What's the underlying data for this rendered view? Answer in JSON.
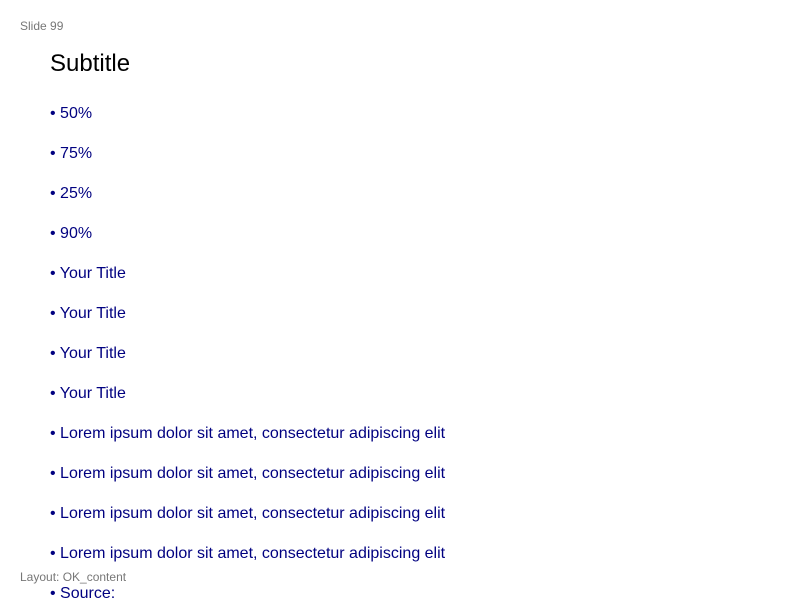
{
  "slide": {
    "number_label": "Slide 99",
    "title": "Subtitle",
    "layout_label": "Layout: OK_content",
    "bullets": [
      "• 50%",
      "• 75%",
      "• 25%",
      "• 90%",
      "• Your Title",
      "• Your Title",
      "• Your Title",
      "• Your Title",
      "• Lorem ipsum dolor sit amet, consectetur adipiscing elit",
      "• Lorem ipsum dolor sit amet, consectetur adipiscing elit",
      "• Lorem ipsum dolor sit amet, consectetur adipiscing elit",
      "• Lorem ipsum dolor sit amet, consectetur adipiscing elit",
      "• Source:"
    ]
  },
  "colors": {
    "background": "#ffffff",
    "bullet_text": "#000080",
    "title_text": "#000000",
    "meta_text": "#777777"
  }
}
